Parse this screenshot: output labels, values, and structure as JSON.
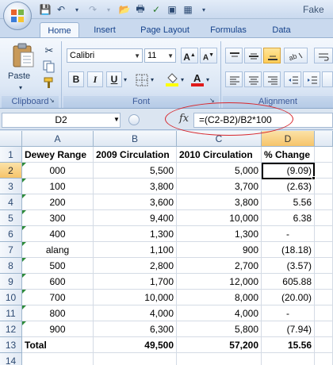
{
  "titlebar": {
    "title": "Fake"
  },
  "tabs": [
    "Home",
    "Insert",
    "Page Layout",
    "Formulas",
    "Data"
  ],
  "ribbon": {
    "paste_label": "Paste",
    "font_name": "Calibri",
    "font_size": "11",
    "groups": [
      "Clipboard",
      "Font",
      "Alignment"
    ],
    "format_buttons": [
      "B",
      "I",
      "U"
    ]
  },
  "formula_bar": {
    "name_box": "D2",
    "fx": "fx",
    "formula": "=(C2-B2)/B2*100"
  },
  "sheet": {
    "columns": [
      "A",
      "B",
      "C",
      "D"
    ],
    "rows": [
      {
        "n": "1",
        "a": "Dewey Range",
        "b": "2009 Circulation",
        "c": "2010 Circulation",
        "d": "% Change"
      },
      {
        "n": "2",
        "a": "000",
        "b": "5,500",
        "c": "5,000",
        "d": "(9.09)"
      },
      {
        "n": "3",
        "a": "100",
        "b": "3,800",
        "c": "3,700",
        "d": "(2.63)"
      },
      {
        "n": "4",
        "a": "200",
        "b": "3,600",
        "c": "3,800",
        "d": "5.56"
      },
      {
        "n": "5",
        "a": "300",
        "b": "9,400",
        "c": "10,000",
        "d": "6.38"
      },
      {
        "n": "6",
        "a": "400",
        "b": "1,300",
        "c": "1,300",
        "d": "-"
      },
      {
        "n": "7",
        "a": "alang",
        "b": "1,100",
        "c": "900",
        "d": "(18.18)"
      },
      {
        "n": "8",
        "a": "500",
        "b": "2,800",
        "c": "2,700",
        "d": "(3.57)"
      },
      {
        "n": "9",
        "a": "600",
        "b": "1,700",
        "c": "12,000",
        "d": "605.88"
      },
      {
        "n": "10",
        "a": "700",
        "b": "10,000",
        "c": "8,000",
        "d": "(20.00)"
      },
      {
        "n": "11",
        "a": "800",
        "b": "4,000",
        "c": "4,000",
        "d": "-"
      },
      {
        "n": "12",
        "a": "900",
        "b": "6,300",
        "c": "5,800",
        "d": "(7.94)"
      },
      {
        "n": "13",
        "a": "Total",
        "b": "49,500",
        "c": "57,200",
        "d": "15.56"
      },
      {
        "n": "14",
        "a": "",
        "b": "",
        "c": "",
        "d": ""
      }
    ]
  },
  "colors": {
    "accent": "#15428b",
    "selection_header": "#f6c46a",
    "annotation_ellipse": "#d7262c",
    "text_indicator": "#2e8b3a"
  }
}
